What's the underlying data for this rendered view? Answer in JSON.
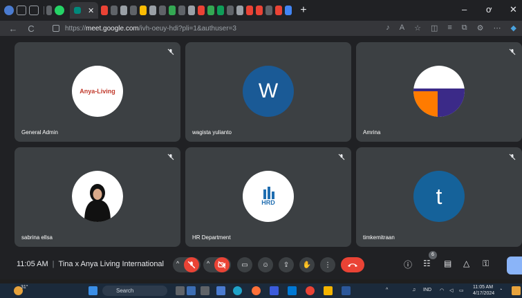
{
  "browser": {
    "active_tab_close": "✕",
    "new_tab": "+",
    "win_min": "–",
    "win_max": "ơ",
    "win_close": "✕",
    "back": "←",
    "reload": "C",
    "url_prefix": "https://",
    "url_host": "meet.google.com",
    "url_path": "/ivh-oeuy-hdi?pli=1&authuser=3"
  },
  "tiles": [
    {
      "name": "General Admin",
      "avatar": "logo",
      "logo_text": "Anya-Living"
    },
    {
      "name": "wagista yulianto",
      "avatar": "letter",
      "letter": "W"
    },
    {
      "name": "Amrina",
      "avatar": "pie"
    },
    {
      "name": "sabrina ellsa",
      "avatar": "photo"
    },
    {
      "name": "HR Department",
      "avatar": "logo",
      "logo_text": "HRD"
    },
    {
      "name": "timkemitraan",
      "avatar": "letter",
      "letter": "t"
    }
  ],
  "controls": {
    "time": "11:05 AM",
    "meeting_title": "Tina x Anya Living International",
    "participants_count": "6"
  },
  "taskbar": {
    "weather": "31°",
    "search_placeholder": "Search",
    "lang": "IND",
    "time": "11:05 AM",
    "date": "4/17/2024"
  },
  "colors": {
    "tile_bg": "#3c4043",
    "stage_bg": "#202124",
    "danger": "#ea4335",
    "accent": "#8ab4f8"
  }
}
